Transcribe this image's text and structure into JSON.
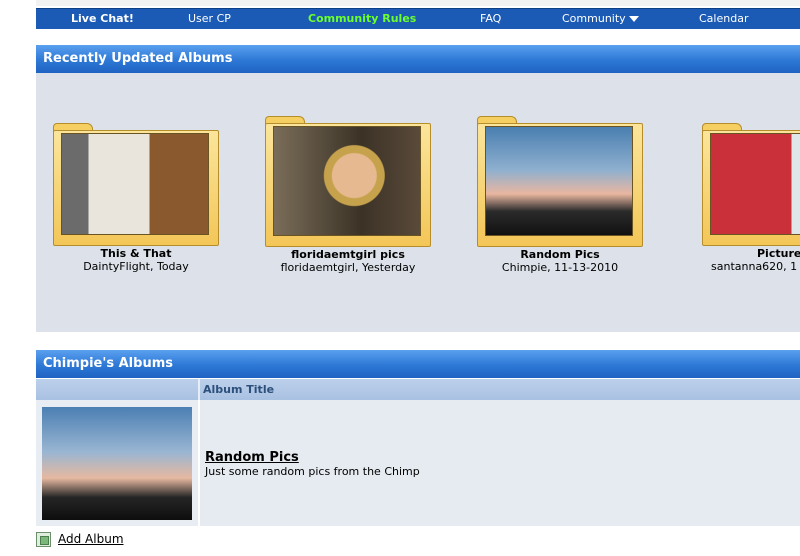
{
  "nav": {
    "items": [
      {
        "label": "Live Chat!"
      },
      {
        "label": "User CP"
      },
      {
        "label": "Community Rules"
      },
      {
        "label": "FAQ"
      },
      {
        "label": "Community"
      },
      {
        "label": "Calendar"
      }
    ]
  },
  "recent": {
    "heading": "Recently Updated Albums",
    "albums": [
      {
        "title": "This & That",
        "meta": "DaintyFlight, Today"
      },
      {
        "title": "floridaemtgirl pics",
        "meta": "floridaemtgirl, Yesterday"
      },
      {
        "title": "Random Pics",
        "meta": "Chimpie, 11-13-2010"
      },
      {
        "title": "Picture",
        "meta": "santanna620, 1"
      }
    ]
  },
  "user_albums": {
    "heading": "Chimpie's Albums",
    "column_title": "Album Title",
    "rows": [
      {
        "title": "Random Pics",
        "description": "Just some random pics from the Chimp"
      }
    ]
  },
  "actions": {
    "add_album": "Add Album"
  },
  "colors": {
    "nav_bg": "#1b5bb5",
    "rules_link": "#6cff2e",
    "header_blue": "#2d78d6",
    "panel_bg": "#dde2ea"
  }
}
